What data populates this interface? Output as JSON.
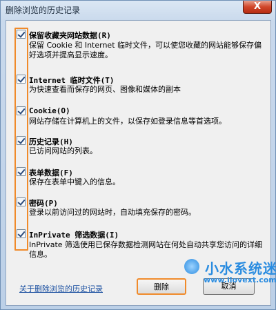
{
  "window": {
    "title": "删除浏览的历史记录",
    "close_label": "X"
  },
  "items": [
    {
      "title": "保留收藏夹网站数据(R)",
      "desc": "保留 Cookie 和 Internet 临时文件，可以使您收藏的网站能够保存偏好选项并提高显示速度。",
      "checked": true
    },
    {
      "title": "Internet 临时文件(T)",
      "desc": "为快速查看而保存的网页、图像和媒体的副本",
      "checked": true
    },
    {
      "title": "Cookie(O)",
      "desc": "网站存储在计算机上的文件，以保存如登录信息等首选项。",
      "checked": true
    },
    {
      "title": "历史记录(H)",
      "desc": "已访问网站的列表。",
      "checked": true
    },
    {
      "title": "表单数据(F)",
      "desc": "保存在表单中键入的信息。",
      "checked": true
    },
    {
      "title": "密码(P)",
      "desc": "登录以前访问过的网站时，自动填充保存的密码。",
      "checked": true
    },
    {
      "title": "InPrivate 筛选数据(I)",
      "desc": "InPrivate 筛选使用已保存数据检测网站在何处自动共享您访问的详细信息。",
      "checked": true
    }
  ],
  "footer": {
    "link": "关于删除浏览的历史记录",
    "delete_button": "删除",
    "cancel_button": "取消"
  },
  "watermark": {
    "name": "小水系统迷",
    "url": "www.ilovext.com"
  }
}
